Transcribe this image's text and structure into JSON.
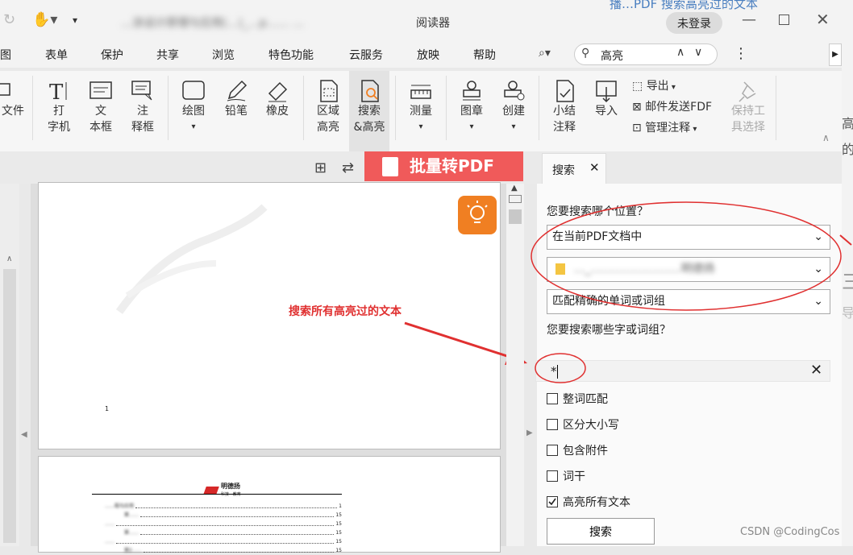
{
  "title": {
    "blurred_title": "…涂设计原理与应用(…)_…p…… …",
    "suffix": "阅读器",
    "login": "未登录",
    "bg_link": "播…PDF 搜索高亮过的文本"
  },
  "menu": [
    "图",
    "表单",
    "保护",
    "共享",
    "浏览",
    "特色功能",
    "云服务",
    "放映",
    "帮助"
  ],
  "search_box": {
    "value": "高亮"
  },
  "ribbon": {
    "file": "文件",
    "typewriter": [
      "打",
      "字机"
    ],
    "textbox": [
      "文",
      "本框"
    ],
    "note": [
      "注",
      "释框"
    ],
    "draw": "绘图",
    "pencil": "铅笔",
    "eraser": "橡皮",
    "area": [
      "区域",
      "高亮"
    ],
    "search_hl": [
      "搜索",
      "&高亮"
    ],
    "measure": "测量",
    "stamp": "图章",
    "create": "创建",
    "summary": [
      "小结",
      "注释"
    ],
    "import": "导入",
    "export": "导出",
    "mail": "邮件发送FDF",
    "manage": "管理注释",
    "keep": [
      "保持工",
      "具选择"
    ]
  },
  "banner": "批量转PDF",
  "panel_tab": "搜索",
  "panel": {
    "where_label": "您要搜索哪个位置？",
    "where_value": "在当前PDF文档中",
    "folder_value": "…_……………………明德扬",
    "match_value": "匹配精确的单词或词组",
    "what_label": "您要搜索哪些字或词组？",
    "query_value": "*",
    "options": [
      {
        "label": "整词匹配",
        "checked": false
      },
      {
        "label": "区分大小写",
        "checked": false
      },
      {
        "label": "包含附件",
        "checked": false
      },
      {
        "label": "词干",
        "checked": false
      },
      {
        "label": "高亮所有文本",
        "checked": true
      }
    ],
    "search_button": "搜索"
  },
  "annotation": "搜索所有高亮过的文本",
  "page_number": "1",
  "toc": {
    "logo_text": "明德扬",
    "logo_sub": "科技 · 教育",
    "rows": [
      {
        "label": "……程与应用",
        "num": "1"
      },
      {
        "label": "第……",
        "num": "15"
      },
      {
        "label": "……",
        "num": "15"
      },
      {
        "label": "第……",
        "num": "15"
      },
      {
        "label": "……",
        "num": "15"
      },
      {
        "label": "第2……",
        "num": "15"
      }
    ]
  },
  "right_fragments": [
    "高亮",
    "的文",
    "三",
    "导注"
  ],
  "watermark": "CSDN @CodingCos",
  "colors": {
    "red": "#e03030",
    "orange": "#f07f22",
    "banner": "#f05a5a"
  }
}
